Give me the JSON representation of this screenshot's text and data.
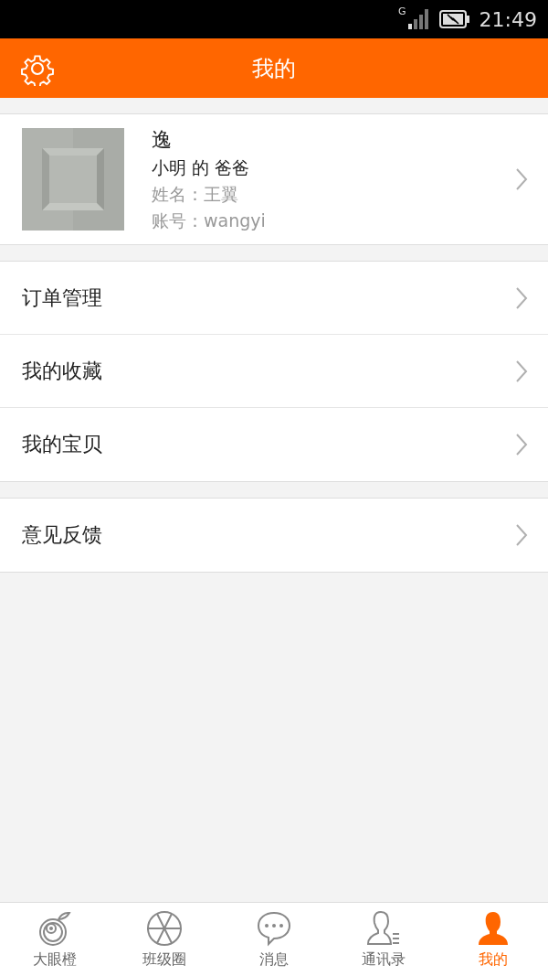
{
  "status_bar": {
    "network": "G",
    "time": "21:49"
  },
  "header": {
    "title": "我的"
  },
  "profile": {
    "name": "逸",
    "relation": "小明 的 爸爸",
    "real_name": "姓名：王翼",
    "account": "账号：wangyi"
  },
  "menu_groups": [
    {
      "items": [
        {
          "label": "订单管理"
        },
        {
          "label": "我的收藏"
        },
        {
          "label": "我的宝贝"
        }
      ]
    },
    {
      "items": [
        {
          "label": "意见反馈"
        }
      ]
    }
  ],
  "tab_bar": [
    {
      "label": "大眼橙",
      "selected": false
    },
    {
      "label": "班级圈",
      "selected": false
    },
    {
      "label": "消息",
      "selected": false
    },
    {
      "label": "通讯录",
      "selected": false
    },
    {
      "label": "我的",
      "selected": true
    }
  ]
}
